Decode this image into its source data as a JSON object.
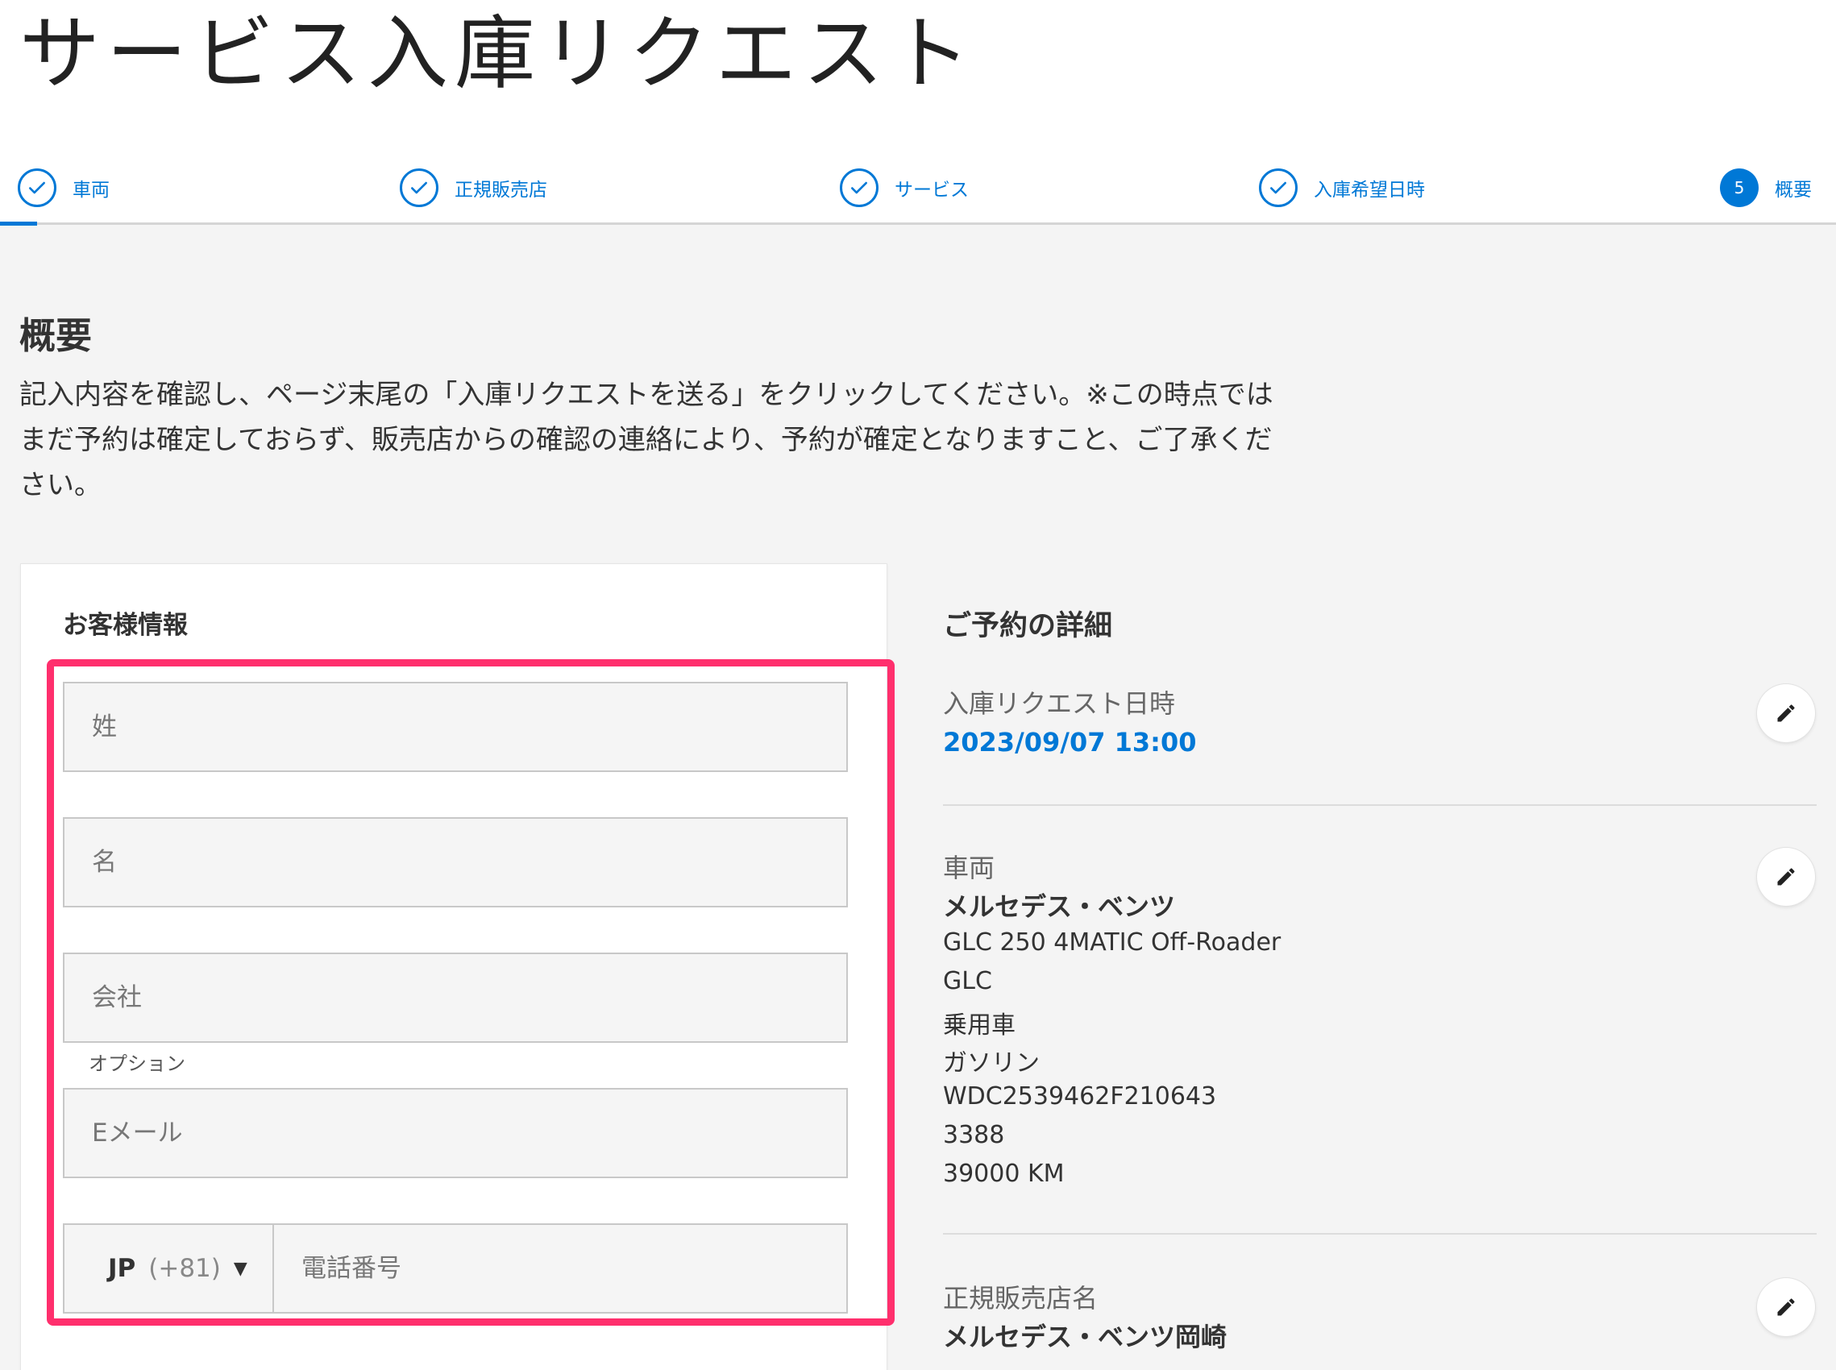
{
  "page_title": "サービス入庫リクエスト",
  "steps": [
    {
      "label": "車両",
      "status": "done"
    },
    {
      "label": "正規販売店",
      "status": "done"
    },
    {
      "label": "サービス",
      "status": "done"
    },
    {
      "label": "入庫希望日時",
      "status": "done"
    },
    {
      "label": "概要",
      "status": "current",
      "number": "5"
    }
  ],
  "summary": {
    "title": "概要",
    "description": "記入内容を確認し、ページ末尾の「入庫リクエストを送る」をクリックしてください。※この時点ではまだ予約は確定しておらず、販売店からの確認の連絡により、予約が確定となりますこと、ご了承ください。"
  },
  "customer": {
    "title": "お客様情報",
    "last_name_placeholder": "姓",
    "first_name_placeholder": "名",
    "company_placeholder": "会社",
    "company_hint": "オプション",
    "email_placeholder": "Eメール",
    "phone": {
      "country_code": "JP",
      "dial_code": "(+81)",
      "placeholder": "電話番号"
    }
  },
  "details": {
    "title": "ご予約の詳細",
    "appointment": {
      "label": "入庫リクエスト日時",
      "value": "2023/09/07 13:00"
    },
    "vehicle": {
      "label": "車両",
      "brand": "メルセデス・ベンツ",
      "lines": [
        "GLC 250 4MATIC Off-Roader",
        "GLC",
        "乗用車",
        "ガソリン",
        "WDC2539462F210643",
        "3388",
        "39000 KM"
      ]
    },
    "dealer": {
      "label": "正規販売店名",
      "name": "メルセデス・ベンツ岡崎"
    }
  },
  "colors": {
    "accent": "#0078d6",
    "highlight": "#ff2f6d",
    "background": "#f4f4f4"
  },
  "icons": {
    "step_done": "check-icon",
    "edit": "pencil-icon",
    "dropdown": "caret-down-icon"
  }
}
